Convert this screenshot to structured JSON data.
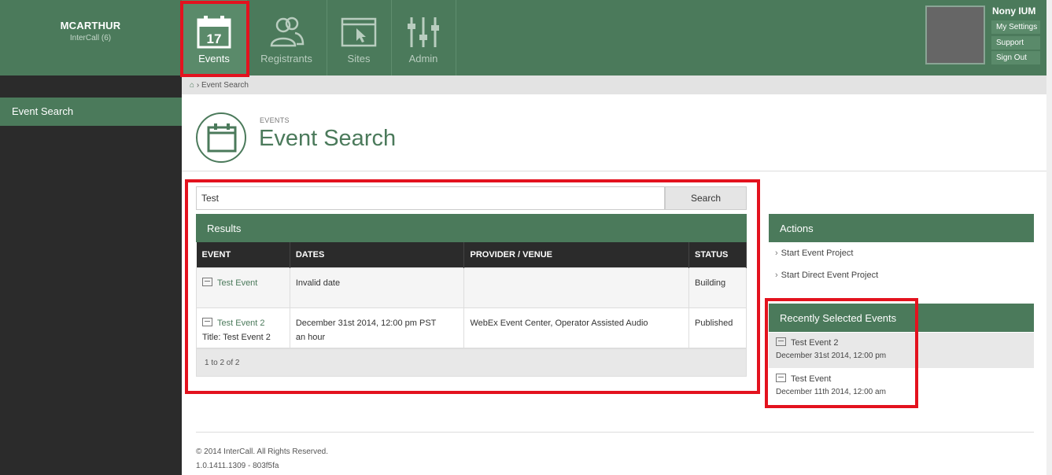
{
  "brand": {
    "org": "MCARTHUR",
    "sub": "InterCall (6)"
  },
  "nav": {
    "tabs": [
      {
        "label": "Events",
        "icon": "calendar-icon",
        "day": "17"
      },
      {
        "label": "Registrants",
        "icon": "people-icon"
      },
      {
        "label": "Sites",
        "icon": "browser-window-icon"
      },
      {
        "label": "Admin",
        "icon": "sliders-icon"
      }
    ]
  },
  "user": {
    "name": "Nony IUM",
    "menu": [
      "My Settings",
      "Support",
      "Sign Out"
    ]
  },
  "sidebar": {
    "items": [
      {
        "label": "Event Search"
      }
    ]
  },
  "breadcrumb": {
    "current": "Event Search"
  },
  "page": {
    "eyebrow": "EVENTS",
    "title": "Event Search"
  },
  "search": {
    "value": "Test",
    "button": "Search"
  },
  "results": {
    "title": "Results",
    "columns": [
      "EVENT",
      "DATES",
      "PROVIDER / VENUE",
      "STATUS"
    ],
    "rows": [
      {
        "event": "Test Event",
        "event_sub": "",
        "dates": "Invalid date",
        "dates_sub": "",
        "provider": "",
        "status": "Building"
      },
      {
        "event": "Test Event 2",
        "event_sub": "Title: Test Event 2",
        "dates": "December 31st 2014, 12:00 pm PST",
        "dates_sub": "an hour",
        "provider": "WebEx Event Center, Operator Assisted Audio",
        "status": "Published"
      }
    ],
    "footer": "1 to 2 of 2"
  },
  "actions": {
    "title": "Actions",
    "items": [
      "Start Event Project",
      "Start Direct Event Project"
    ]
  },
  "recent": {
    "title": "Recently Selected Events",
    "items": [
      {
        "name": "Test Event 2",
        "date": "December 31st 2014, 12:00 pm"
      },
      {
        "name": "Test Event",
        "date": "December 11th 2014, 12:00 am"
      }
    ]
  },
  "footer": {
    "copyright": "© 2014 InterCall. All Rights Reserved.",
    "version": "1.0.1411.1309 - 803f5fa"
  },
  "colors": {
    "brand": "#4b7a5b",
    "sidebar": "#2b2b2b",
    "highlight": "#e3121e"
  }
}
